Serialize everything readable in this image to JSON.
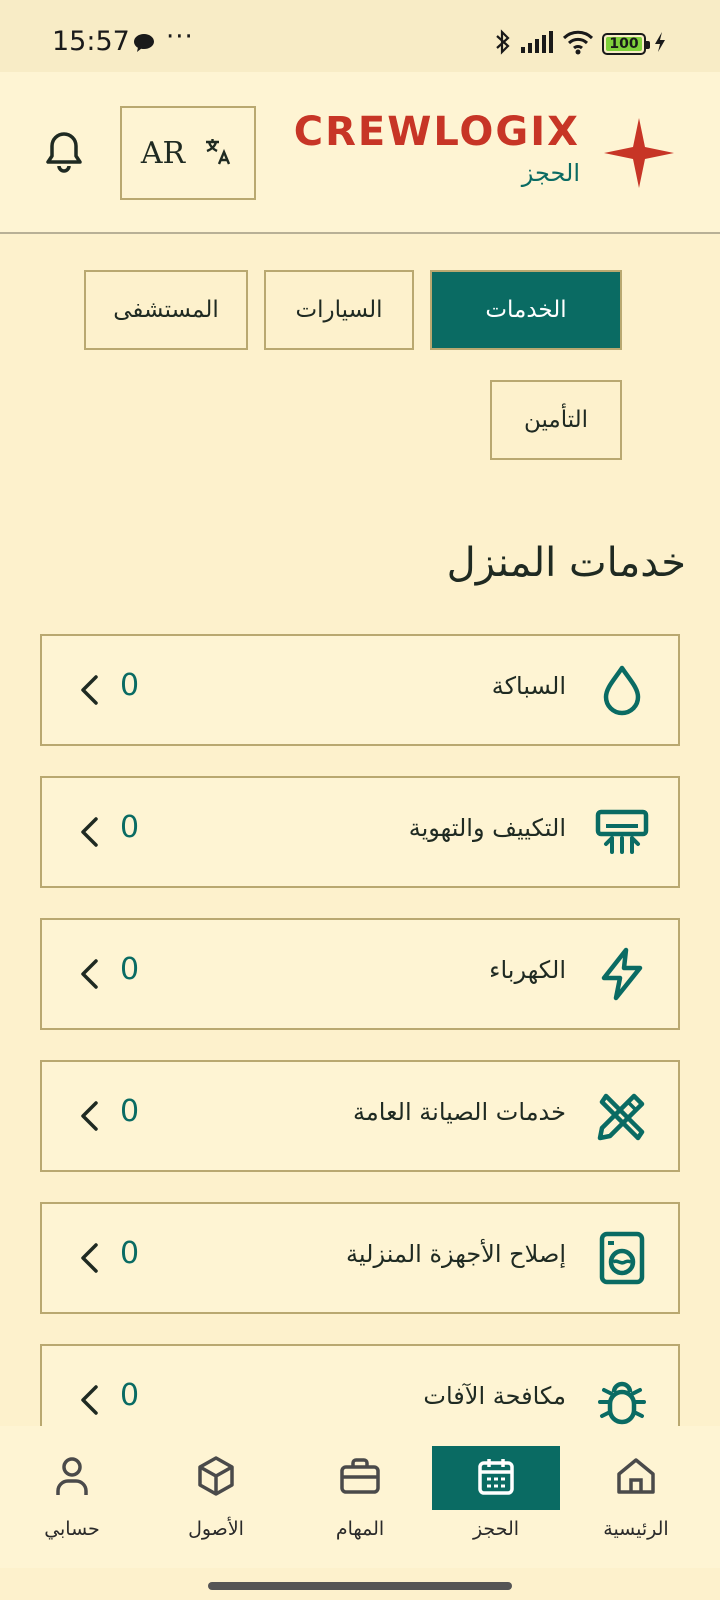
{
  "status_bar": {
    "time": "15:57",
    "dots": "···",
    "battery": "100"
  },
  "header": {
    "brand": "CREWLOGIX",
    "subtitle": "الحجز",
    "language": "AR"
  },
  "tabs": [
    {
      "label": "الخدمات",
      "active": true
    },
    {
      "label": "السيارات",
      "active": false
    },
    {
      "label": "المستشفى",
      "active": false
    },
    {
      "label": "التأمين",
      "active": false
    }
  ],
  "section": {
    "title": "خدمات المنزل"
  },
  "services": [
    {
      "label": "السباكة",
      "count": "0",
      "icon": "water-drop-icon"
    },
    {
      "label": "التكييف والتهوية",
      "count": "0",
      "icon": "air-conditioner-icon"
    },
    {
      "label": "الكهرباء",
      "count": "0",
      "icon": "lightning-icon"
    },
    {
      "label": "خدمات الصيانة العامة",
      "count": "0",
      "icon": "tools-icon"
    },
    {
      "label": "إصلاح الأجهزة المنزلية",
      "count": "0",
      "icon": "washing-machine-icon"
    },
    {
      "label": "مكافحة الآفات",
      "count": "0",
      "icon": "bug-icon"
    }
  ],
  "bottom_nav": [
    {
      "label": "حسابي",
      "icon": "user-icon",
      "active": false
    },
    {
      "label": "الأصول",
      "icon": "cube-icon",
      "active": false
    },
    {
      "label": "المهام",
      "icon": "briefcase-icon",
      "active": false
    },
    {
      "label": "الحجز",
      "icon": "calendar-icon",
      "active": true
    },
    {
      "label": "الرئيسية",
      "icon": "home-icon",
      "active": false
    }
  ],
  "colors": {
    "background": "#FDF1CC",
    "primary": "#0A6B63",
    "brand_red": "#C73526",
    "border": "#B9A870"
  }
}
